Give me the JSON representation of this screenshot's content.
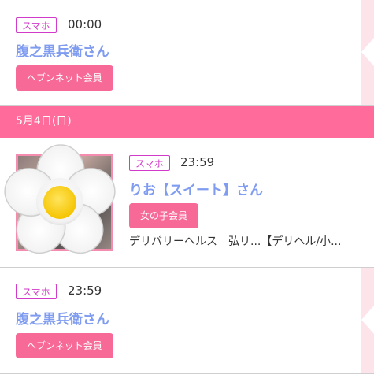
{
  "entries": [
    {
      "device": "スマホ",
      "time": "00:00",
      "name": "腹之黒兵衛さん",
      "member": "ヘブンネット会員"
    },
    {
      "device": "スマホ",
      "time": "23:59",
      "name": "りお【スイート】さん",
      "member": "女の子会員",
      "shop": "デリバリーヘルス　弘リ...【デリヘル/小..."
    },
    {
      "device": "スマホ",
      "time": "23:59",
      "name": "腹之黒兵衛さん",
      "member": "ヘブンネット会員"
    }
  ],
  "date_header": "5月4日(日)",
  "colors": {
    "accent_pink": "#ff6c9b",
    "tag_magenta": "#d23ac9",
    "name_blue": "#7f9cf0",
    "button_pink": "#f76a98"
  },
  "icons": {
    "photo_overlay": "white-daisy-flower-icon"
  }
}
